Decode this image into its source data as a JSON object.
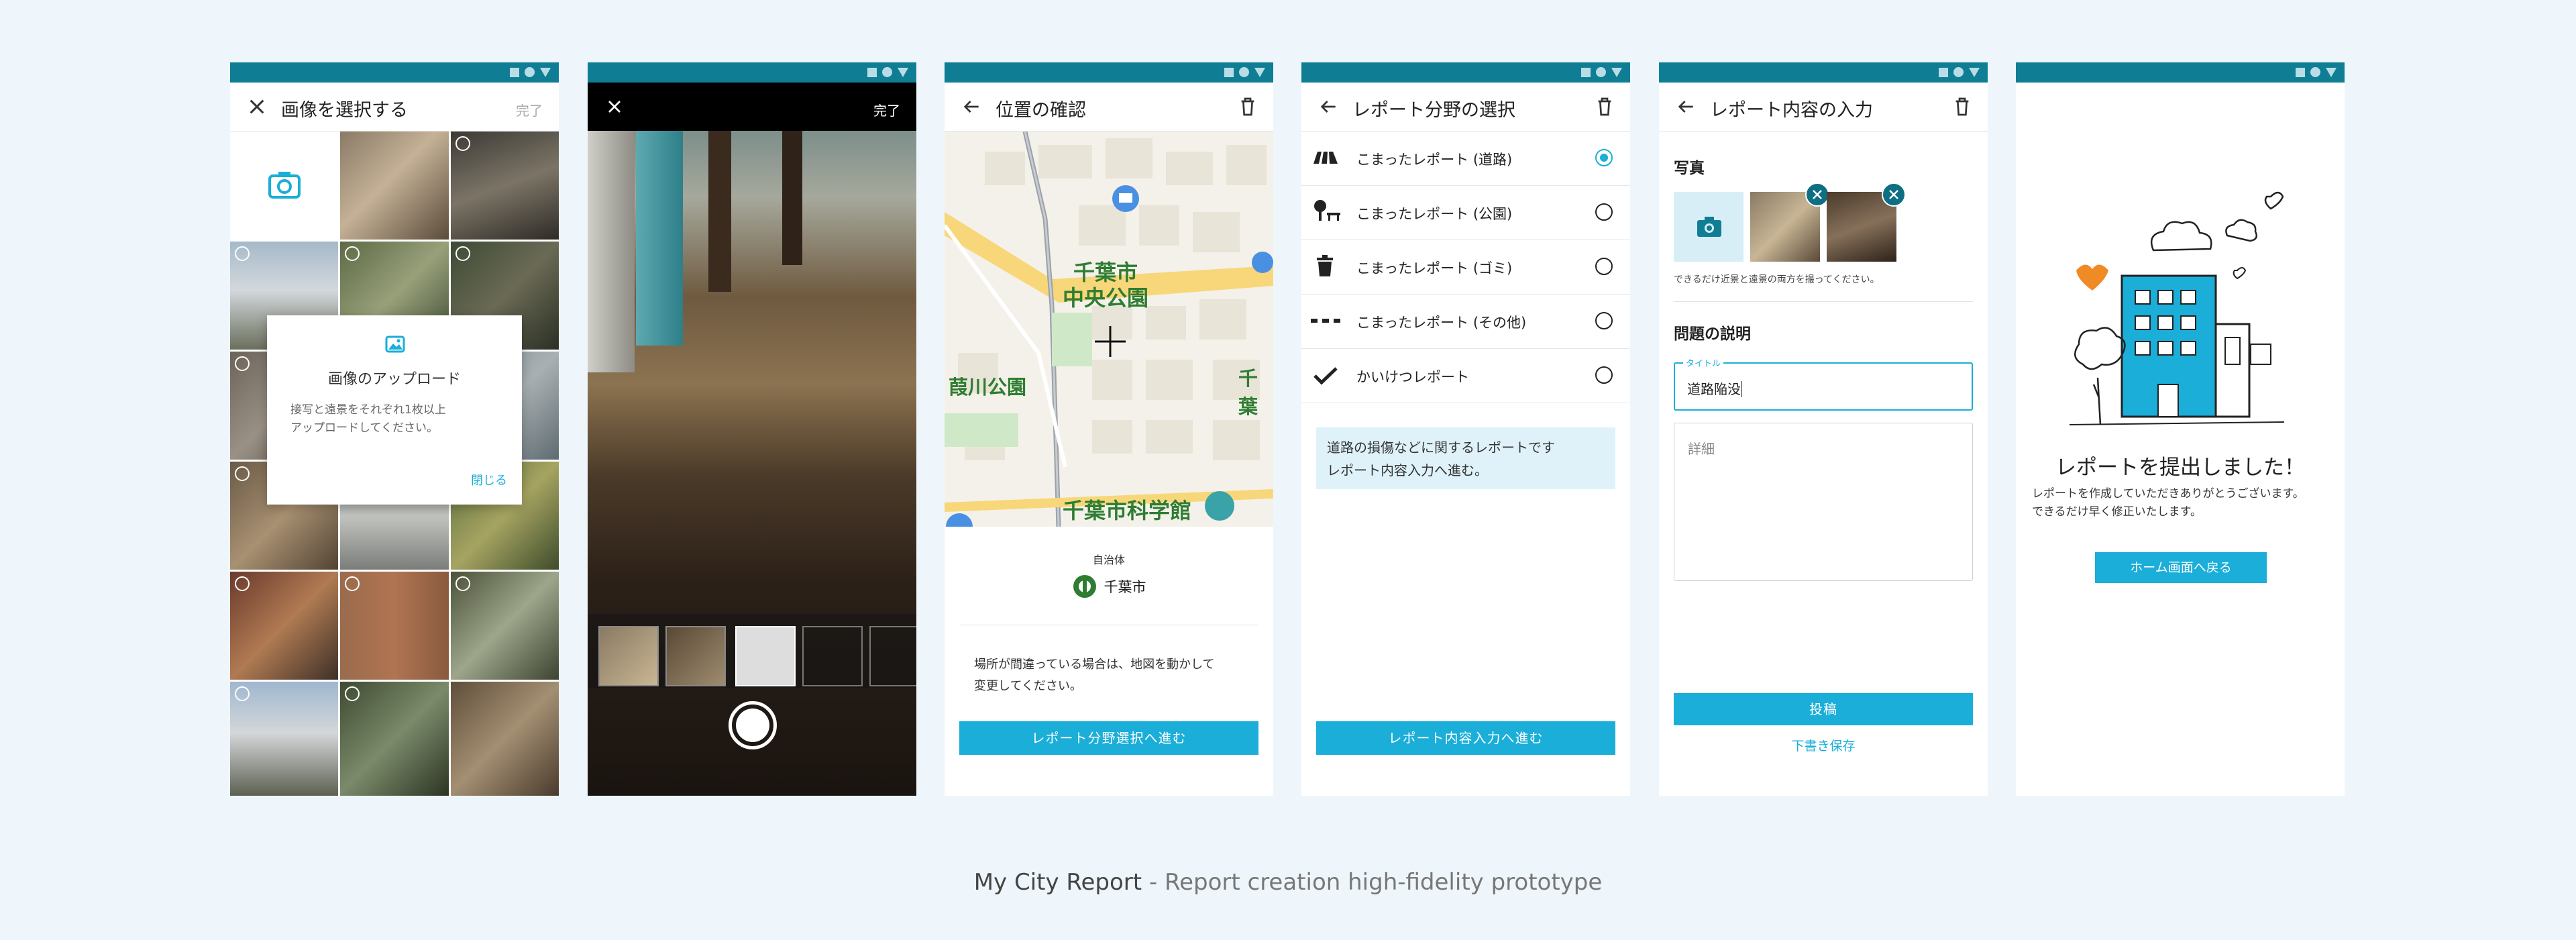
{
  "caption": {
    "brand": "My City Report",
    "rest": " - Report creation high-fidelity prototype"
  },
  "s1": {
    "title": "画像を選択する",
    "done": "完了",
    "dialog": {
      "title": "画像のアップロード",
      "body1": "接写と遠景をそれぞれ1枚以上",
      "body2": "アップロードしてください。",
      "close": "閉じる"
    }
  },
  "s2": {
    "done": "完了"
  },
  "s3": {
    "title": "位置の確認",
    "map": {
      "station": "千葉市",
      "park": "中央公園",
      "west": "葭川公園",
      "east": "千葉",
      "museum": "千葉市科学館"
    },
    "authority_label": "自治体",
    "authority_name": "千葉市",
    "note1": "場所が間違っている場合は、地図を動かして",
    "note2": "変更してください。",
    "cta": "レポート分野選択へ進む"
  },
  "s4": {
    "title": "レポート分野の選択",
    "options": [
      {
        "label": "こまったレポート (道路)"
      },
      {
        "label": "こまったレポート (公園)"
      },
      {
        "label": "こまったレポート (ゴミ)"
      },
      {
        "label": "こまったレポート (その他)"
      },
      {
        "label": "かいけつレポート"
      }
    ],
    "info1": "道路の損傷などに関するレポートです",
    "info2": "レポート内容入力へ進む。",
    "cta": "レポート内容入力へ進む"
  },
  "s5": {
    "title": "レポート内容の入力",
    "photos_label": "写真",
    "photos_note": "できるだけ近景と遠景の両方を撮ってください。",
    "problem_label": "問題の説明",
    "title_field_label": "タイトル",
    "title_value": "道路陥没",
    "detail_placeholder": "詳細",
    "submit": "投稿",
    "draft": "下書き保存"
  },
  "s6": {
    "heading": "レポートを提出しました！",
    "body1": "レポートを作成していただきありがとうございます。",
    "body2": "できるだけ早く修正いたします。",
    "cta": "ホーム画面へ戻る"
  },
  "colors": {
    "accent": "#1aaed8",
    "statusbar": "#0f7e95",
    "background": "#eef6fb"
  }
}
